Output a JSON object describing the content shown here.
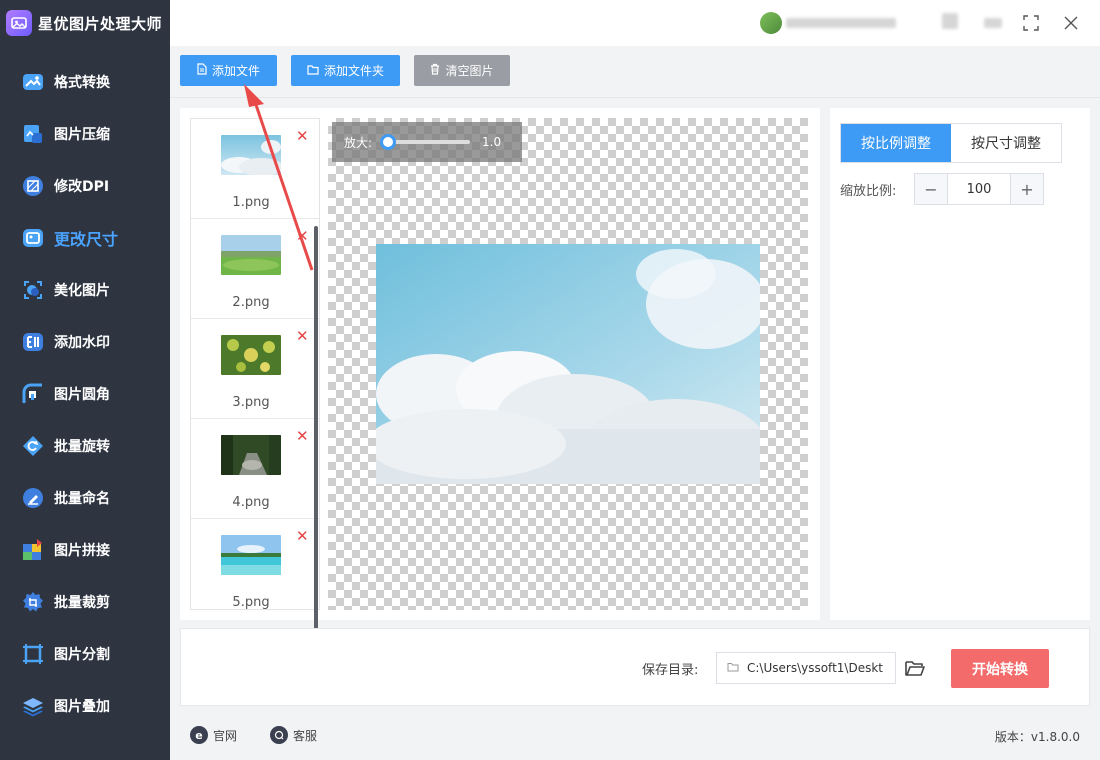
{
  "app": {
    "name": "星优图片处理大师"
  },
  "sidebar": {
    "items": [
      {
        "label": "格式转换",
        "icon": "image-convert-icon",
        "active": false
      },
      {
        "label": "图片压缩",
        "icon": "compress-icon",
        "active": false
      },
      {
        "label": "修改DPI",
        "icon": "dpi-icon",
        "active": false
      },
      {
        "label": "更改尺寸",
        "icon": "resize-icon",
        "active": true
      },
      {
        "label": "美化图片",
        "icon": "beautify-icon",
        "active": false
      },
      {
        "label": "添加水印",
        "icon": "watermark-icon",
        "active": false
      },
      {
        "label": "图片圆角",
        "icon": "rounded-corner-icon",
        "active": false
      },
      {
        "label": "批量旋转",
        "icon": "rotate-icon",
        "active": false
      },
      {
        "label": "批量命名",
        "icon": "rename-icon",
        "active": false
      },
      {
        "label": "图片拼接",
        "icon": "puzzle-icon",
        "active": false
      },
      {
        "label": "批量裁剪",
        "icon": "crop-icon",
        "active": false
      },
      {
        "label": "图片分割",
        "icon": "split-icon",
        "active": false
      },
      {
        "label": "图片叠加",
        "icon": "layers-icon",
        "active": false
      }
    ]
  },
  "toolbar": {
    "add_file": "添加文件",
    "add_folder": "添加文件夹",
    "clear_images": "清空图片"
  },
  "files": [
    {
      "name": "1.png",
      "thumb": "sky-clouds"
    },
    {
      "name": "2.png",
      "thumb": "meadow"
    },
    {
      "name": "3.png",
      "thumb": "yellow-flowers"
    },
    {
      "name": "4.png",
      "thumb": "forest-stream"
    },
    {
      "name": "5.png",
      "thumb": "beach"
    }
  ],
  "preview": {
    "zoom_label": "放大:",
    "zoom_value": "1.0",
    "zoom_fraction": 0
  },
  "settings": {
    "tab_ratio": "按比例调整",
    "tab_size": "按尺寸调整",
    "active_tab": "ratio",
    "scale_label": "缩放比例:",
    "scale_value": "100",
    "minus": "−",
    "plus": "+"
  },
  "output": {
    "save_label": "保存目录:",
    "save_path": "C:\\Users\\yssoft1\\Deskt",
    "start_button": "开始转换"
  },
  "statusbar": {
    "website": "官网",
    "support": "客服",
    "version": "版本：v1.8.0.0"
  },
  "colors": {
    "accent": "#3d9bf5",
    "sidebar_bg": "#2e3440",
    "active_nav": "#4aa3ff",
    "start": "#f46b6b",
    "delete": "#e64545"
  }
}
